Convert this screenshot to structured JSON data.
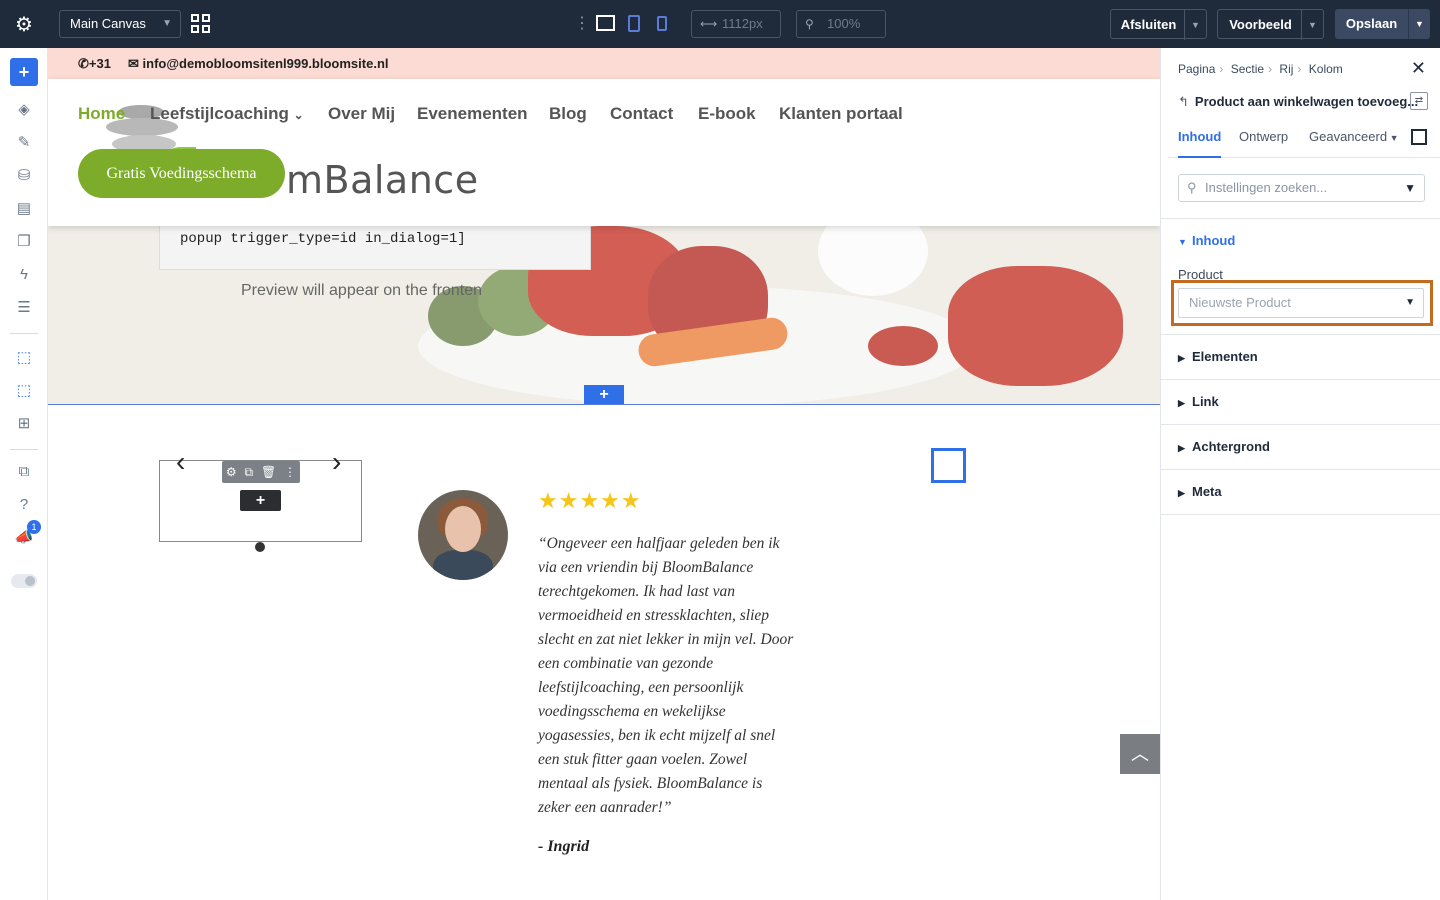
{
  "topbar": {
    "canvas_select": "Main Canvas",
    "width_value": "1112px",
    "zoom_value": "100%",
    "close_label": "Afsluiten",
    "preview_label": "Voorbeeld",
    "save_label": "Opslaan"
  },
  "sidebar": {
    "add_label": "+",
    "badge_count": "1"
  },
  "site": {
    "phone": "+31",
    "email": "info@demobloomsitenl999.bloomsite.nl",
    "logo_text": "mBalance",
    "nav": [
      "Home",
      "Leefstijlcoaching",
      "Over Mij",
      "Evenementen",
      "Blog",
      "Contact",
      "E-book",
      "Klanten portaal"
    ],
    "nav_caret": "⌄",
    "cta_label": "Gratis Voedingsschema",
    "code_text": "popup trigger_type=id in_dialog=1]",
    "preview_text": "Preview will appear on the fronten",
    "stars": "★★★★★",
    "quote": "“Ongeveer een halfjaar geleden ben ik via een vriendin bij BloomBalance terechtgekomen. Ik had last van vermoeidheid en stressklachten, sliep slecht en zat niet lekker in mijn vel. Door een combinatie van gezonde leefstijlcoaching, een persoonlijk voedingsschema en wekelijkse yogasessies, ben ik echt mijzelf al snel een stuk fitter gaan voelen. Zowel mentaal als fysiek. BloomBalance is zeker een aanrader!”",
    "author": "- Ingrid",
    "arrow_left": "‹",
    "arrow_right": "›",
    "add_plus": "+"
  },
  "panel": {
    "breadcrumbs": [
      "Pagina",
      "Sectie",
      "Rij",
      "Kolom"
    ],
    "module_title": "Product aan winkelwagen toevoeg...",
    "tabs": [
      "Inhoud",
      "Ontwerp",
      "Geavanceerd"
    ],
    "search_placeholder": "Instellingen zoeken...",
    "groups": [
      "Inhoud",
      "Elementen",
      "Link",
      "Achtergrond",
      "Meta"
    ],
    "product_label": "Product",
    "product_value": "Nieuwste Product"
  },
  "colors": {
    "accent": "#2f6fe8",
    "topbar_bg": "#1f2b3a",
    "brand_green": "#7cac2a",
    "highlight_outline": "#c46b1f"
  }
}
